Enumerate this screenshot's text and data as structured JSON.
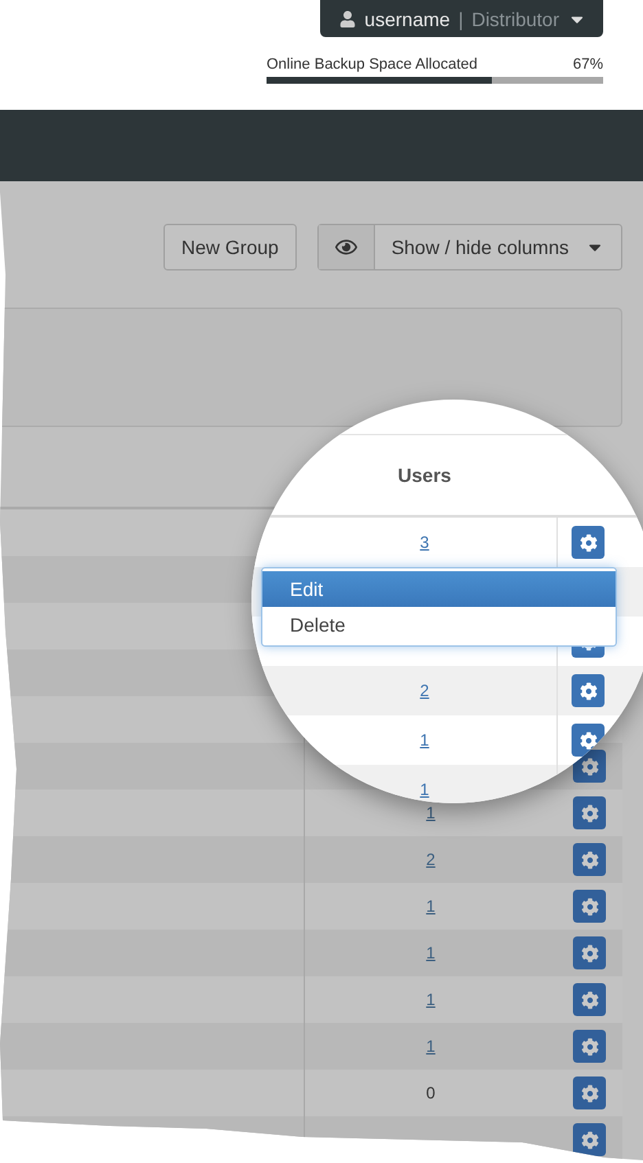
{
  "account": {
    "username": "username",
    "separator": "|",
    "role": "Distributor"
  },
  "storage": {
    "label": "Online Backup Space Allocated",
    "reading": "67%",
    "level": 0.67
  },
  "toolbar": {
    "new_group": "New Group",
    "columns_toggle": "Show / hide columns"
  },
  "table": {
    "rows": [
      {
        "kind": "hidden"
      },
      {
        "kind": "hidden"
      },
      {
        "kind": "hidden"
      },
      {
        "kind": "hidden"
      },
      {
        "kind": "hidden"
      },
      {
        "kind": "covered"
      },
      {
        "kind": "link",
        "users": "1"
      },
      {
        "kind": "link",
        "users": "2"
      },
      {
        "kind": "link",
        "users": "1"
      },
      {
        "kind": "link",
        "users": "1"
      },
      {
        "kind": "link",
        "users": "1"
      },
      {
        "kind": "link",
        "users": "1"
      },
      {
        "kind": "plain",
        "users": "0"
      },
      {
        "kind": "covered"
      }
    ]
  },
  "magnifier": {
    "header": "Users",
    "rows": [
      {
        "kind": "link",
        "users": "3"
      },
      {
        "kind": "hidden"
      },
      {
        "kind": "covered"
      },
      {
        "kind": "link",
        "users": "2"
      },
      {
        "kind": "link",
        "users": "1"
      },
      {
        "kind": "edge",
        "users": "1"
      }
    ],
    "menu": [
      {
        "label": "Edit",
        "selected": true
      },
      {
        "label": "Delete",
        "selected": false
      }
    ]
  }
}
